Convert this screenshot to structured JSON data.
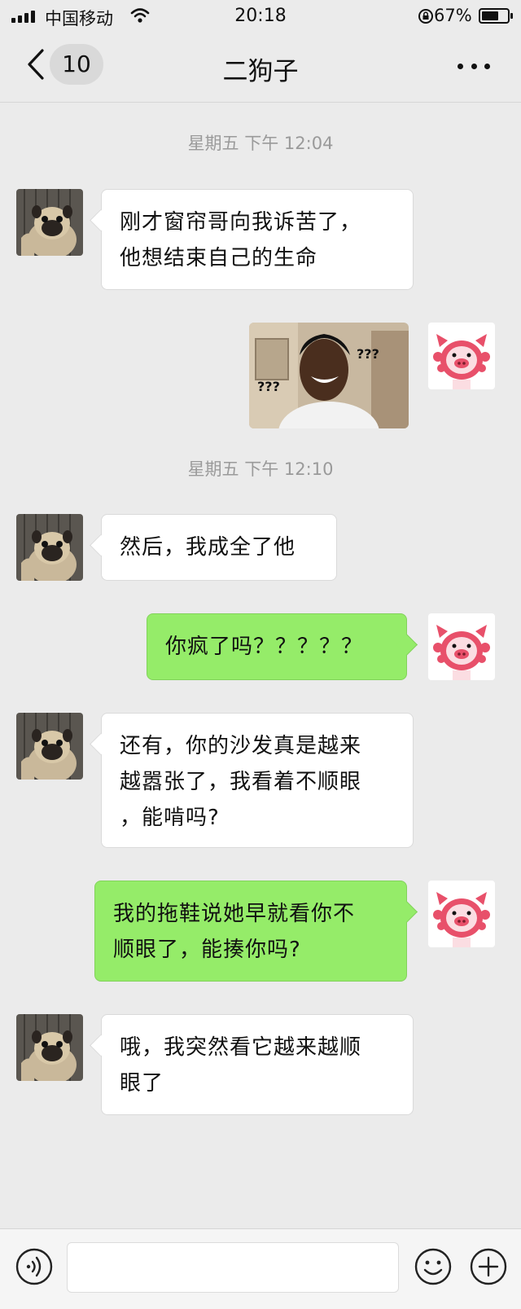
{
  "status_bar": {
    "carrier": "中国移动",
    "time": "20:18",
    "battery": "67%",
    "battery_level": 0.67,
    "icons": [
      "signal-icon",
      "wifi-icon",
      "rotation-lock-icon",
      "battery-icon"
    ]
  },
  "nav": {
    "title": "二狗子",
    "unread_count": "10",
    "icons": [
      "back-chevron-icon",
      "more-icon"
    ]
  },
  "messages": [
    {
      "type": "timestamp",
      "text": "星期五 下午 12:04"
    },
    {
      "type": "text",
      "from": "friend",
      "text": "刚才窗帘哥向我诉苦了，\n他想结束自己的生命"
    },
    {
      "type": "image",
      "from": "me",
      "caption_marks": [
        "???",
        "???"
      ]
    },
    {
      "type": "timestamp",
      "text": "星期五 下午 12:10"
    },
    {
      "type": "text",
      "from": "friend",
      "text": "然后，我成全了他"
    },
    {
      "type": "text",
      "from": "me",
      "text": "你疯了吗？？？？？"
    },
    {
      "type": "text",
      "from": "friend",
      "text": "还有，你的沙发真是越来\n越嚣张了，我看着不顺眼\n，能啃吗?"
    },
    {
      "type": "text",
      "from": "me",
      "text": "我的拖鞋说她早就看你不\n顺眼了，能揍你吗?"
    },
    {
      "type": "text",
      "from": "friend",
      "text": "哦，我突然看它越来越顺\n眼了"
    }
  ],
  "input_bar": {
    "placeholder": "",
    "icons": [
      "voice-icon",
      "emoji-icon",
      "plus-icon"
    ]
  },
  "colors": {
    "background": "#ebebeb",
    "bubble_in": "#ffffff",
    "bubble_out": "#95ec69",
    "timestamp": "#9a9a9a"
  }
}
